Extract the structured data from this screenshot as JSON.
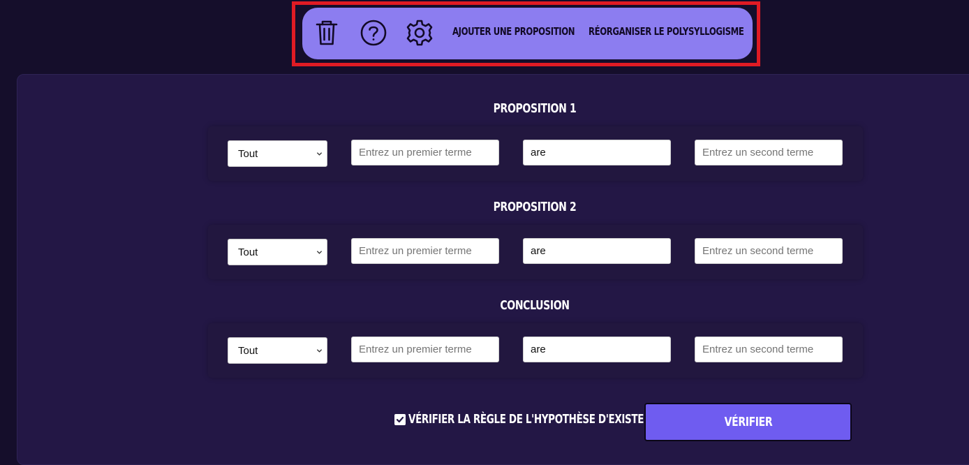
{
  "toolbar": {
    "icons": [
      "trash-icon",
      "help-icon",
      "gear-icon"
    ],
    "add_label": "Ajouter une proposition",
    "reorganize_label": "Réorganiser le polysyllogisme",
    "highlight_color": "#e01b24",
    "background_color": "#8c7df0"
  },
  "propositions": [
    {
      "title": "Proposition 1",
      "quantifier": "Tout",
      "first_term_placeholder": "Entrez un premier terme",
      "first_term_value": "",
      "copula": "are",
      "second_term_placeholder": "Entrez un second terme",
      "second_term_value": ""
    },
    {
      "title": "Proposition 2",
      "quantifier": "Tout",
      "first_term_placeholder": "Entrez un premier terme",
      "first_term_value": "",
      "copula": "are",
      "second_term_placeholder": "Entrez un second terme",
      "second_term_value": ""
    },
    {
      "title": "Conclusion",
      "quantifier": "Tout",
      "first_term_placeholder": "Entrez un premier terme",
      "first_term_value": "",
      "copula": "are",
      "second_term_placeholder": "Entrez un second terme",
      "second_term_value": ""
    }
  ],
  "footer": {
    "checkbox_label": "Vérifier la règle de l'hypothèse d'existence",
    "checkbox_checked": true,
    "verify_label": "Vérifier",
    "verify_color": "#6f5cf0"
  },
  "colors": {
    "page_background": "#150e2b",
    "panel_background": "#231745"
  }
}
